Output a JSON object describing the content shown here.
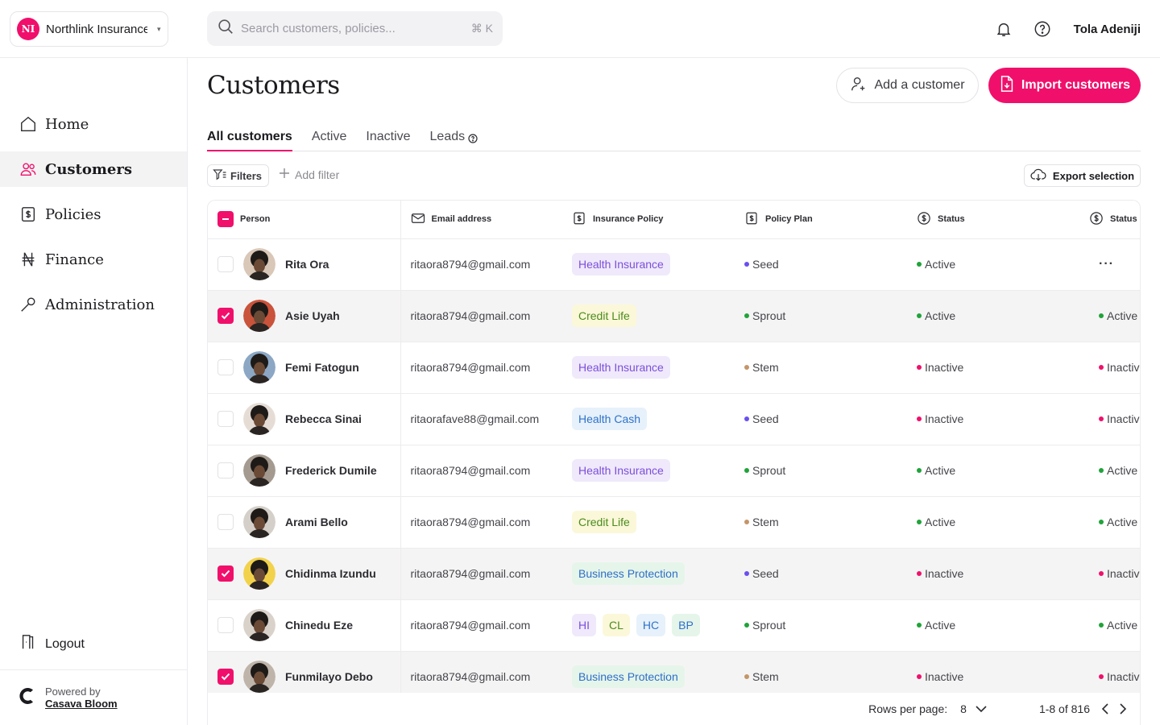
{
  "org": {
    "initials": "NI",
    "name": "Northlink Insurance"
  },
  "search": {
    "placeholder": "Search customers, policies...",
    "shortcut": "⌘ K"
  },
  "user": {
    "name": "Tola Adeniji"
  },
  "sidebar": {
    "items": [
      {
        "label": "Home",
        "icon": "home-icon",
        "active": false
      },
      {
        "label": "Customers",
        "icon": "users-icon",
        "active": true
      },
      {
        "label": "Policies",
        "icon": "policy-document-icon",
        "active": false
      },
      {
        "label": "Finance",
        "icon": "naira-icon",
        "active": false
      },
      {
        "label": "Administration",
        "icon": "wrench-icon",
        "active": false
      }
    ],
    "logout": "Logout",
    "powered_by": "Powered by",
    "brand": "Casava Bloom"
  },
  "page": {
    "title": "Customers",
    "add_customer": "Add a customer",
    "import_customers": "Import customers"
  },
  "tabs": [
    "All customers",
    "Active",
    "Inactive",
    "Leads"
  ],
  "toolbar": {
    "filters": "Filters",
    "add_filter": "Add filter",
    "export": "Export selection"
  },
  "table": {
    "columns": {
      "person": "Person",
      "email": "Email address",
      "policy": "Insurance Policy",
      "plan": "Policy Plan",
      "status": "Status",
      "status2": "Status"
    },
    "rows": [
      {
        "name": "Rita Ora",
        "email": "ritaora8794@gmail.com",
        "policies": [
          "Health Insurance"
        ],
        "plan": "Seed",
        "status": "Active",
        "status2": "",
        "selected": false
      },
      {
        "name": "Asie Uyah",
        "email": "ritaora8794@gmail.com",
        "policies": [
          "Credit Life"
        ],
        "plan": "Sprout",
        "status": "Active",
        "status2": "Active",
        "selected": true
      },
      {
        "name": "Femi Fatogun",
        "email": "ritaora8794@gmail.com",
        "policies": [
          "Health Insurance"
        ],
        "plan": "Stem",
        "status": "Inactive",
        "status2": "Inactive",
        "selected": false
      },
      {
        "name": "Rebecca Sinai",
        "email": "ritaorafave88@gmail.com",
        "policies": [
          "Health Cash"
        ],
        "plan": "Seed",
        "status": "Inactive",
        "status2": "Inactive",
        "selected": false
      },
      {
        "name": "Frederick Dumile",
        "email": "ritaora8794@gmail.com",
        "policies": [
          "Health Insurance"
        ],
        "plan": "Sprout",
        "status": "Active",
        "status2": "Active",
        "selected": false
      },
      {
        "name": "Arami Bello",
        "email": "ritaora8794@gmail.com",
        "policies": [
          "Credit Life"
        ],
        "plan": "Stem",
        "status": "Active",
        "status2": "Active",
        "selected": false
      },
      {
        "name": "Chidinma Izundu",
        "email": "ritaora8794@gmail.com",
        "policies": [
          "Business Protection"
        ],
        "plan": "Seed",
        "status": "Inactive",
        "status2": "Inactive",
        "selected": true
      },
      {
        "name": "Chinedu Eze",
        "email": "ritaora8794@gmail.com",
        "policies": [
          "HI",
          "CL",
          "HC",
          "BP"
        ],
        "plan": "Sprout",
        "status": "Active",
        "status2": "Active",
        "selected": false
      },
      {
        "name": "Funmilayo Debo",
        "email": "ritaora8794@gmail.com",
        "policies": [
          "Business Protection"
        ],
        "plan": "Stem",
        "status": "Inactive",
        "status2": "Inactive",
        "selected": true
      }
    ]
  },
  "pager": {
    "rows_label": "Rows per page:",
    "rows_value": "8",
    "range": "1-8 of 816"
  },
  "colors": {
    "accent": "#f0106b",
    "active": "#20a33a",
    "inactive": "#f0106b",
    "seed": "#6b4ff0",
    "sprout": "#20a33a",
    "stem": "#c4956a",
    "tag_health_insurance": {
      "bg": "#efe9fb",
      "fg": "#7c4fd9"
    },
    "tag_credit_life": {
      "bg": "#fbf7d9",
      "fg": "#4a8c1d"
    },
    "tag_health_cash": {
      "bg": "#e6f1fb",
      "fg": "#2f72c9"
    },
    "tag_business_protection": {
      "bg": "#e5f5ea",
      "fg": "#2f6ec9"
    }
  }
}
